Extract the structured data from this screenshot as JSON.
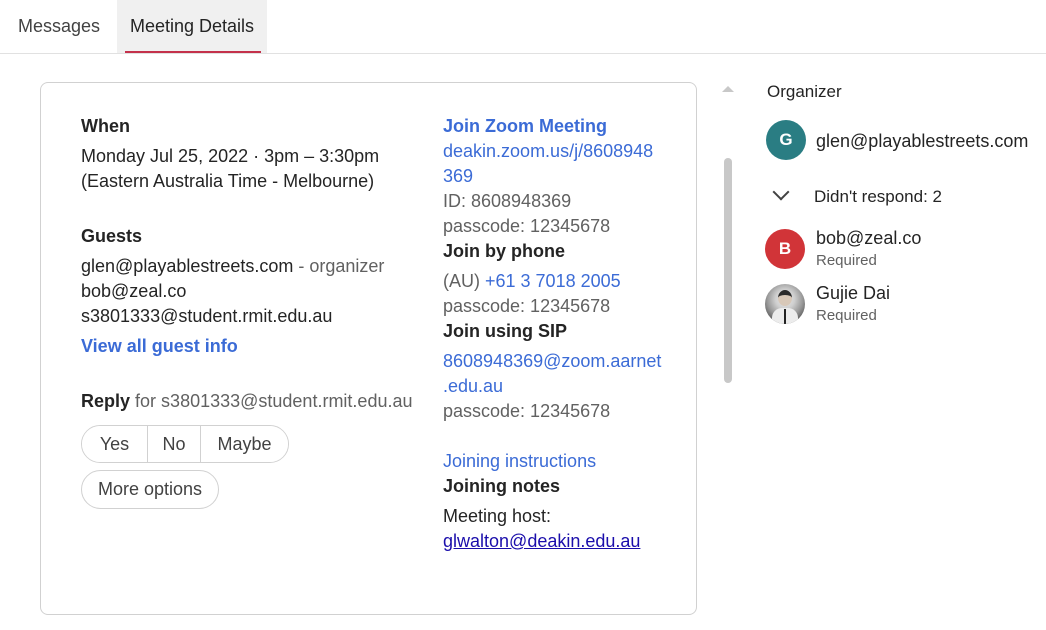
{
  "tabs": [
    {
      "label": "Messages"
    },
    {
      "label": "Meeting Details"
    }
  ],
  "details": {
    "when_heading": "When",
    "when_line1": "Monday Jul 25, 2022 · 3pm – 3:30pm",
    "when_line2": "(Eastern Australia Time - Melbourne)",
    "guests_heading": "Guests",
    "guests": [
      {
        "email": "glen@playablestreets.com",
        "role": " - organizer"
      },
      {
        "email": "bob@zeal.co"
      },
      {
        "email": "s3801333@student.rmit.edu.au"
      }
    ],
    "view_all": "View all guest info",
    "reply_label": "Reply",
    "reply_for": "for s3801333@student.rmit.edu.au",
    "reply_options": [
      "Yes",
      "No",
      "Maybe"
    ],
    "more_options": "More options"
  },
  "zoom": {
    "join_title": "Join Zoom Meeting",
    "url_line1": "deakin.zoom.us/j/8608948",
    "url_line2": "369",
    "id_line": "ID: 8608948369",
    "passcode1": "passcode: 12345678",
    "phone_heading": "Join by phone",
    "phone_region": "(AU) ",
    "phone_number": "+61 3 7018 2005",
    "passcode2": "passcode: 12345678",
    "sip_heading": "Join using SIP",
    "sip_line1": "8608948369@zoom.aarnet",
    "sip_line2": ".edu.au",
    "passcode3": "passcode: 12345678",
    "instructions_link": "Joining instructions",
    "notes_heading": "Joining notes",
    "host_label": "Meeting host:",
    "host_email": "glwalton@deakin.edu.au"
  },
  "attendees": {
    "organizer_title": "Organizer",
    "organizer": {
      "initial": "G",
      "email": "glen@playablestreets.com",
      "color": "#2a7d83"
    },
    "didnt_respond": "Didn't respond: 2",
    "people": [
      {
        "initial": "B",
        "name": "bob@zeal.co",
        "status": "Required",
        "color": "#d13438"
      },
      {
        "name": "Gujie Dai",
        "status": "Required"
      }
    ]
  },
  "colors": {
    "accent": "#c4314b",
    "link": "#3b6bd6"
  }
}
